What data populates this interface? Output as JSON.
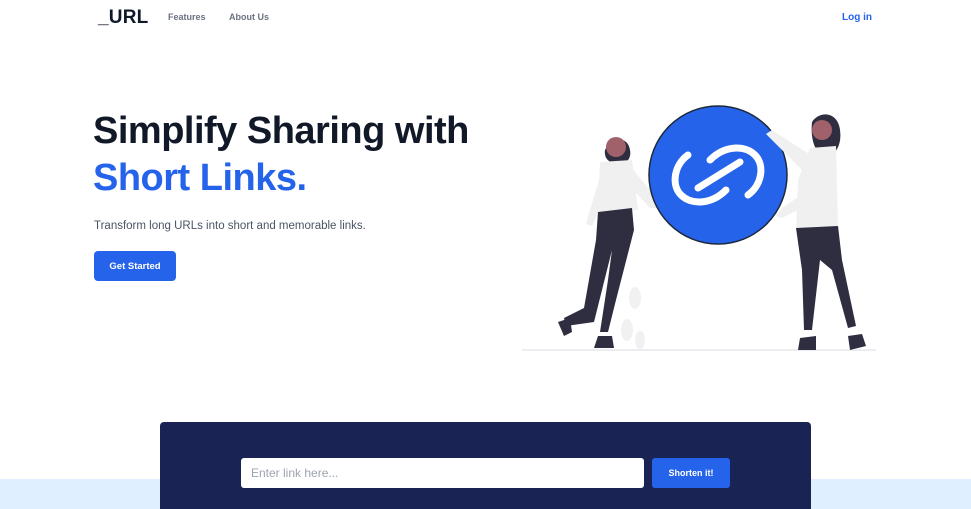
{
  "nav": {
    "logo": "_URL",
    "links": [
      "Features",
      "About Us"
    ],
    "login": "Log in"
  },
  "hero": {
    "title_line1": "Simplify Sharing with",
    "title_line2": "Short Links.",
    "subtitle": "Transform long URLs into short and memorable links.",
    "cta": "Get Started"
  },
  "shortener": {
    "placeholder": "Enter link here...",
    "button": "Shorten it!"
  },
  "colors": {
    "brand": "#2563eb",
    "panel": "#1a2454",
    "band": "#e0efff"
  },
  "icons": [
    "chain-link-icon"
  ]
}
